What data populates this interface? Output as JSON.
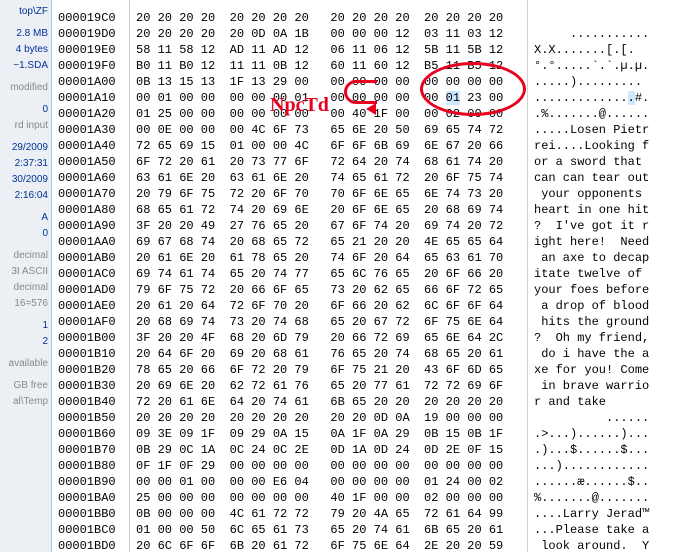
{
  "sidebar": {
    "path": "top\\ZF",
    "size": "2.8 MB",
    "bytes": "4 bytes",
    "file": "~1.SDA",
    "modified": "modified",
    "zero": "0",
    "rdinput": "rd input",
    "date1": "29/2009",
    "time1": "2:37:31",
    "date2": "30/2009",
    "time2": "2:16:04",
    "A": "A",
    "zero2": "0",
    "dec": "decimal",
    "ascii": "3I ASCII",
    "dec2": "decimal",
    "calc": "16=576",
    "one": "1",
    "two": "2",
    "avail": "available",
    "free": "GB free",
    "temp": "al\\Temp"
  },
  "annotation": "NpcTd",
  "selected_byte": "01",
  "addresses": [
    "000019C0",
    "000019D0",
    "000019E0",
    "000019F0",
    "00001A00",
    "00001A10",
    "00001A20",
    "00001A30",
    "00001A40",
    "00001A50",
    "00001A60",
    "00001A70",
    "00001A80",
    "00001A90",
    "00001AA0",
    "00001AB0",
    "00001AC0",
    "00001AD0",
    "00001AE0",
    "00001AF0",
    "00001B00",
    "00001B10",
    "00001B20",
    "00001B30",
    "00001B40",
    "00001B50",
    "00001B60",
    "00001B70",
    "00001B80",
    "00001B90",
    "00001BA0",
    "00001BB0",
    "00001BC0",
    "00001BD0"
  ],
  "hex": [
    "20 20 20 20  20 20 20 20   20 20 20 20  20 20 20 20",
    "20 20 20 20  20 0D 0A 1B   00 00 00 12  03 11 03 12",
    "58 11 58 12  AD 11 AD 12   06 11 06 12  5B 11 5B 12",
    "B0 11 B0 12  11 11 0B 12   60 11 60 12  B5 11 B5 12",
    "0B 13 15 13  1F 13 29 00   00 00 00 00  00 00 00 00",
    "00 01 00 00  00 00 00 01   00 00 00 00  00 01 23 00",
    "01 25 00 00  00 00 00 00   00 40 1F 00  00 02 00 00",
    "00 0E 00 00  00 4C 6F 73   65 6E 20 50  69 65 74 72",
    "72 65 69 15  01 00 00 4C   6F 6F 6B 69  6E 67 20 66",
    "6F 72 20 61  20 73 77 6F   72 64 20 74  68 61 74 20",
    "63 61 6E 20  63 61 6E 20   74 65 61 72  20 6F 75 74",
    "20 79 6F 75  72 20 6F 70   70 6F 6E 65  6E 74 73 20",
    "68 65 61 72  74 20 69 6E   20 6F 6E 65  20 68 69 74",
    "3F 20 20 49  27 76 65 20   67 6F 74 20  69 74 20 72",
    "69 67 68 74  20 68 65 72   65 21 20 20  4E 65 65 64",
    "20 61 6E 20  61 78 65 20   74 6F 20 64  65 63 61 70",
    "69 74 61 74  65 20 74 77   65 6C 76 65  20 6F 66 20",
    "79 6F 75 72  20 66 6F 65   73 20 62 65  66 6F 72 65",
    "20 61 20 64  72 6F 70 20   6F 66 20 62  6C 6F 6F 64",
    "20 68 69 74  73 20 74 68   65 20 67 72  6F 75 6E 64",
    "3F 20 20 4F  68 20 6D 79   20 66 72 69  65 6E 64 2C",
    "20 64 6F 20  69 20 68 61   76 65 20 74  68 65 20 61",
    "78 65 20 66  6F 72 20 79   6F 75 21 20  43 6F 6D 65",
    "20 69 6E 20  62 72 61 76   65 20 77 61  72 72 69 6F",
    "72 20 61 6E  64 20 74 61   6B 65 20 20  20 20 20 20",
    "20 20 20 20  20 20 20 20   20 20 0D 0A  19 00 00 00",
    "09 3E 09 1F  09 29 0A 15   0A 1F 0A 29  0B 15 0B 1F",
    "0B 29 0C 1A  0C 24 0C 2E   0D 1A 0D 24  0D 2E 0F 15",
    "0F 1F 0F 29  00 00 00 00   00 00 00 00  00 00 00 00",
    "00 00 01 00  00 00 E6 04   00 00 00 00  01 24 00 02",
    "25 00 00 00  00 00 00 00   40 1F 00 00  02 00 00 00",
    "0B 00 00 00  4C 61 72 72   79 20 4A 65  72 61 64 99",
    "01 00 00 50  6C 65 61 73   65 20 74 61  6B 65 20 61",
    "20 6C 6F 6F  6B 20 61 72   6F 75 6E 64  2E 20 20 59"
  ],
  "ascii": [
    "                ",
    "     ...........",
    "X.X.­.­.....[.[.",
    "°.°.....`.`.µ.µ.",
    ".....).........",
    ".............#.",
    ".%.......@......",
    ".....Losen Pietr",
    "rei....Looking f",
    "or a sword that ",
    "can can tear out",
    " your opponents ",
    "heart in one hit",
    "?  I've got it r",
    "ight here!  Need",
    " an axe to decap",
    "itate twelve of ",
    "your foes before",
    " a drop of blood",
    " hits the ground",
    "?  Oh my friend,",
    " do i have the a",
    "xe for you! Come",
    " in brave warrio",
    "r and take      ",
    "          ......",
    ".>...)......)...",
    ".)...$......$...",
    "...)............",
    "......æ......$..",
    "%.......@.......",
    "....Larry Jerad™",
    "...Please take a",
    " look around.  Y"
  ]
}
